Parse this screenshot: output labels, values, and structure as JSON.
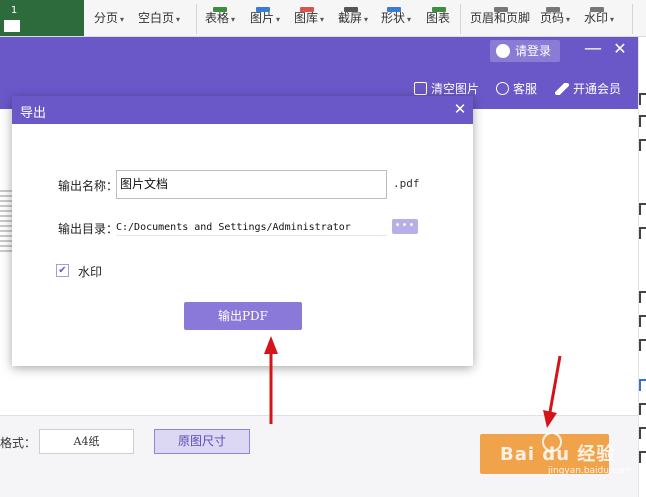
{
  "ribbon": {
    "page_number": "1",
    "items": [
      {
        "label": "分页"
      },
      {
        "label": "空白页"
      },
      {
        "label": "表格"
      },
      {
        "label": "图片"
      },
      {
        "label": "图库"
      },
      {
        "label": "截屏"
      },
      {
        "label": "形状"
      },
      {
        "label": "图表"
      },
      {
        "label": "页眉和页脚"
      },
      {
        "label": "页码"
      },
      {
        "label": "水印"
      }
    ],
    "caret": "▾"
  },
  "app": {
    "login_label": "请登录",
    "minimize_glyph": "—",
    "close_glyph": "✕",
    "toolbar": {
      "clear_images": "清空图片",
      "support": "客服",
      "membership": "开通会员"
    }
  },
  "dialog": {
    "title": "导出",
    "close_glyph": "✕",
    "name_label": "输出名称：",
    "name_value": "图片文档",
    "extension": ".pdf",
    "dir_label": "输出目录：",
    "dir_value": "C:/Documents and Settings/Administrator",
    "browse_label": "•••",
    "watermark_checked": "✔",
    "watermark_label": "水印",
    "export_label": "输出PDF"
  },
  "bottom": {
    "format_label": "格式：",
    "format_value": "A4纸",
    "original_size": "原图尺寸"
  },
  "watermark": {
    "text": "Bai du 经验",
    "sub": "jingyan.baidu.com"
  },
  "colors": {
    "accent_purple": "#6b58c8",
    "export_button": "#8a79d9",
    "start_button": "#f0a34a",
    "arrow_red": "#d4141a"
  }
}
